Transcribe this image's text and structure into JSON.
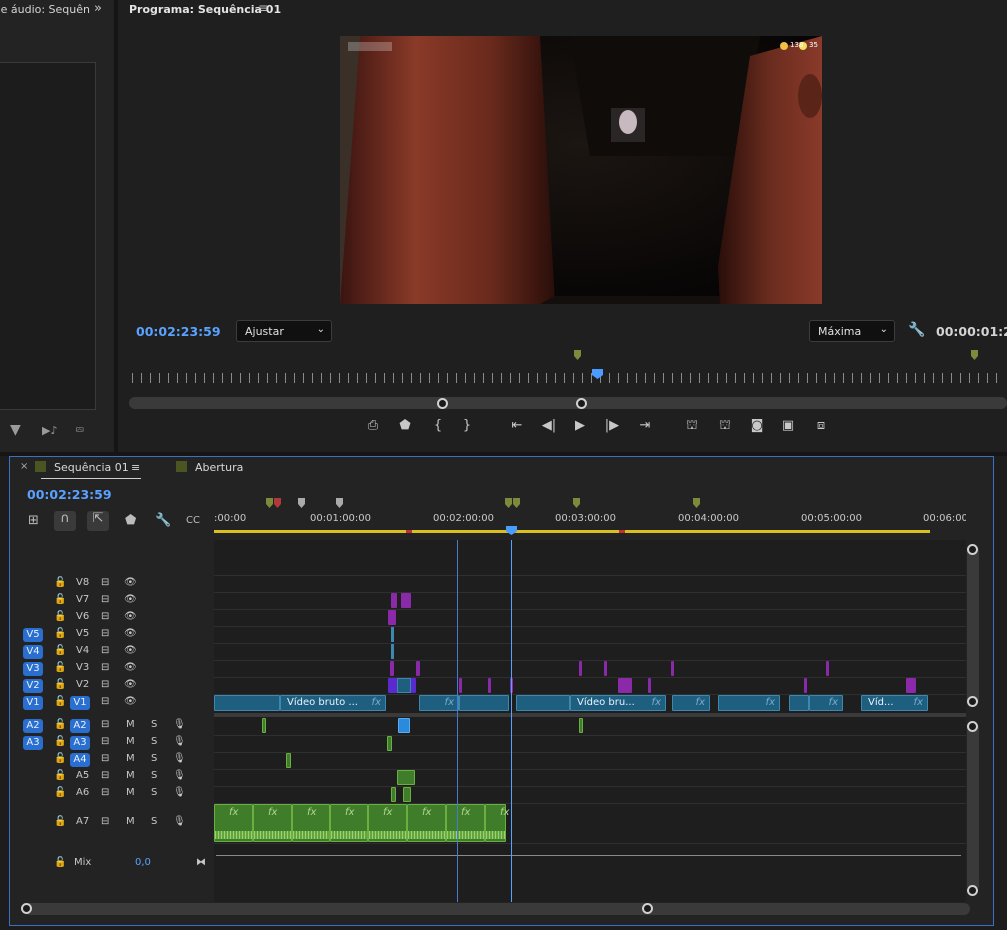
{
  "left_panel": {
    "tab_label": "Mixer de faixa de áudio: Sequên",
    "more_icon": "double-chevron-right-icon",
    "bottom_icons": [
      "filter-icon",
      "play-audio-icon",
      "export-icon"
    ]
  },
  "program_monitor": {
    "title": "Programa: Sequência 01",
    "menu_icon": "hamburger-icon",
    "current_timecode": "00:02:23:59",
    "fit_select": "Ajustar",
    "quality_select": "Máxima",
    "duration_timecode": "00:00:01:2",
    "hud_left": "",
    "hud_right_a": "138",
    "hud_right_b": "35",
    "controls": [
      "add-marker-icon-camera",
      "marker-icon",
      "mark-in-icon",
      "mark-out-icon",
      "go-to-in-icon",
      "step-back-icon",
      "play-icon",
      "step-forward-icon",
      "go-to-out-icon",
      "lift-icon",
      "extract-icon",
      "export-frame-icon",
      "comparison-view-icon",
      "vr-icon"
    ]
  },
  "timeline": {
    "close": "×",
    "tab_active": "Sequência 01",
    "tab_menu": "≡",
    "tab_other": "Abertura",
    "timecode": "00:02:23:59",
    "ruler_labels": [
      ":00:00",
      "00:01:00:00",
      "00:02:00:00",
      "00:03:00:00",
      "00:04:00:00",
      "00:05:00:00",
      "00:06:00:0"
    ],
    "video_tracks": [
      {
        "name": "V8",
        "patch": ""
      },
      {
        "name": "V7",
        "patch": ""
      },
      {
        "name": "V6",
        "patch": ""
      },
      {
        "name": "V5",
        "patch": "V5"
      },
      {
        "name": "V4",
        "patch": "V4"
      },
      {
        "name": "V3",
        "patch": "V3"
      },
      {
        "name": "V2",
        "patch": "V2"
      },
      {
        "name": "V1",
        "patch": "V1",
        "target": "V1"
      }
    ],
    "audio_tracks": [
      {
        "name": "A2",
        "patch": "A2",
        "target": "A2"
      },
      {
        "name": "A3",
        "patch": "A3",
        "target": "A3"
      },
      {
        "name": "A4",
        "target": "A4"
      },
      {
        "name": "A5"
      },
      {
        "name": "A6"
      },
      {
        "name": "A7"
      }
    ],
    "mute_label": "M",
    "solo_label": "S",
    "mix_label": "Mix",
    "mix_value": "0,0",
    "clips": {
      "v1_a": "Vídeo bruto ...",
      "v1_b": "Vídeo bru...",
      "v1_c": "Víd...",
      "fx": "fx"
    }
  }
}
